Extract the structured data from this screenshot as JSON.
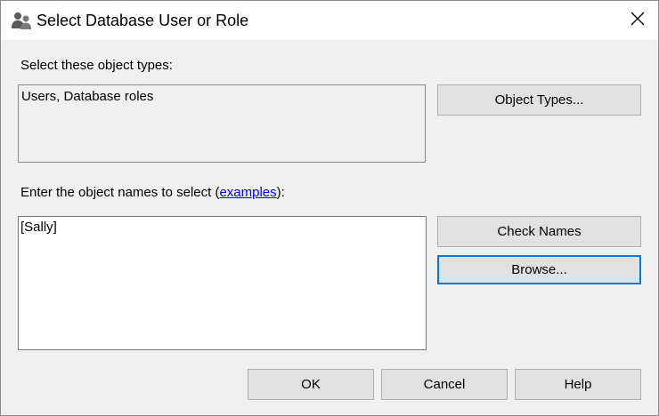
{
  "window": {
    "title": "Select Database User or Role",
    "icon": "users-icon"
  },
  "object_types": {
    "label": "Select these object types:",
    "value": "Users, Database roles",
    "button_label": "Object Types..."
  },
  "object_names": {
    "label_prefix": "Enter the object names to select (",
    "link_text": "examples",
    "label_suffix": "):",
    "value": "[Sally]",
    "check_names_label": "Check Names",
    "browse_label": "Browse..."
  },
  "footer": {
    "ok_label": "OK",
    "cancel_label": "Cancel",
    "help_label": "Help"
  },
  "colors": {
    "focus_border": "#0078d7",
    "link": "#0000ee",
    "button_face": "#e1e1e1"
  }
}
